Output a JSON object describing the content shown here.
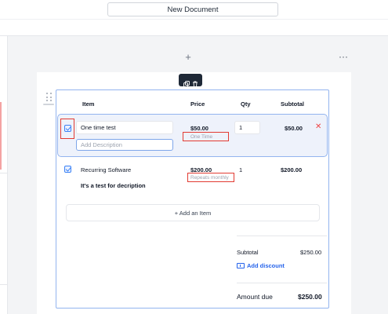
{
  "document": {
    "title": "New Document"
  },
  "toolbar": {
    "add_block": "+",
    "more": "···"
  },
  "table": {
    "headers": {
      "item": "Item",
      "price": "Price",
      "qty": "Qty",
      "subtotal": "Subtotal"
    },
    "rows": [
      {
        "checked": true,
        "name": "One time test",
        "description_placeholder": "Add Description",
        "price": "$50.00",
        "price_type": "One Time",
        "qty": "1",
        "subtotal": "$50.00"
      },
      {
        "checked": true,
        "name": "Recurring Software",
        "description": "It's a test for decription",
        "price": "$200.00",
        "price_type": "Repeats monthly",
        "qty": "1",
        "subtotal": "$200.00"
      }
    ],
    "add_item_label": "+ Add an Item"
  },
  "summary": {
    "subtotal_label": "Subtotal",
    "subtotal_value": "$250.00",
    "discount_label": "Add discount",
    "amount_due_label": "Amount due",
    "amount_due_value": "$250.00"
  },
  "colors": {
    "accent": "#3b82f6",
    "highlight": "#e23b32",
    "remove": "#ef4444"
  },
  "icons": [
    "duplicate-icon",
    "trash-icon",
    "drag-handle-icon",
    "close-icon",
    "ticket-icon",
    "checkbox-checked-icon"
  ]
}
